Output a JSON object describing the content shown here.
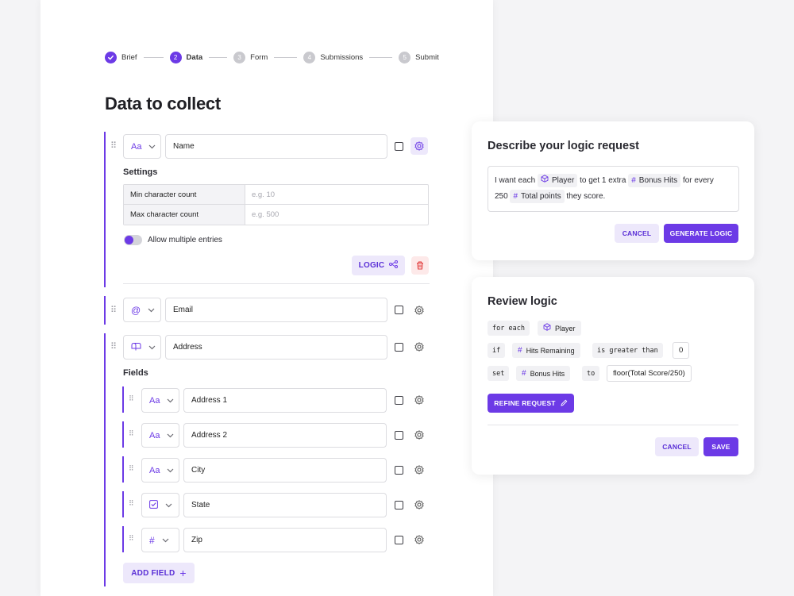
{
  "stepper": {
    "steps": [
      {
        "num": "",
        "label": "Brief"
      },
      {
        "num": "2",
        "label": "Data"
      },
      {
        "num": "3",
        "label": "Form"
      },
      {
        "num": "4",
        "label": "Submissions"
      },
      {
        "num": "5",
        "label": "Submit"
      }
    ]
  },
  "page": {
    "title": "Data to collect"
  },
  "name_field": {
    "type_glyph": "Aa",
    "value": "Name"
  },
  "settings": {
    "heading": "Settings",
    "rows": [
      {
        "key": "Min character count",
        "placeholder": "e.g. 10"
      },
      {
        "key": "Max character count",
        "placeholder": "e.g. 500"
      }
    ],
    "toggle_label": "Allow multiple entries",
    "logic_label": "LOGIC"
  },
  "email_field": {
    "type_glyph": "@",
    "value": "Email"
  },
  "address_field": {
    "type_glyph": "mailbox",
    "value": "Address"
  },
  "sub_fields": {
    "heading": "Fields",
    "items": [
      {
        "type_glyph": "Aa",
        "value": "Address 1"
      },
      {
        "type_glyph": "Aa",
        "value": "Address 2"
      },
      {
        "type_glyph": "Aa",
        "value": "City"
      },
      {
        "type_glyph": "checkbox",
        "value": "State"
      },
      {
        "type_glyph": "#",
        "value": "Zip"
      }
    ],
    "add_label": "ADD FIELD"
  },
  "request_card": {
    "title": "Describe your logic request",
    "text_1": "I want each",
    "chip_1": "Player",
    "text_2": "to get 1 extra",
    "chip_2": "Bonus Hits",
    "text_3": "for every",
    "text_4": "250",
    "chip_3": "Total points",
    "text_5": "they score.",
    "cancel_label": "CANCEL",
    "generate_label": "GENERATE LOGIC"
  },
  "review_card": {
    "title": "Review logic",
    "row1": {
      "kw": "for each",
      "var": "Player"
    },
    "row2": {
      "kw": "if",
      "var": "Hits Remaining",
      "op": "is greater than",
      "val": "0"
    },
    "row3": {
      "kw": "set",
      "var": "Bonus Hits",
      "op": "to",
      "val": "floor(Total Score/250)"
    },
    "refine_label": "REFINE REQUEST",
    "cancel_label": "CANCEL",
    "save_label": "SAVE"
  },
  "colors": {
    "accent": "#6c3ae6",
    "accent_soft": "#ede8fb",
    "danger": "#e23d3d"
  }
}
